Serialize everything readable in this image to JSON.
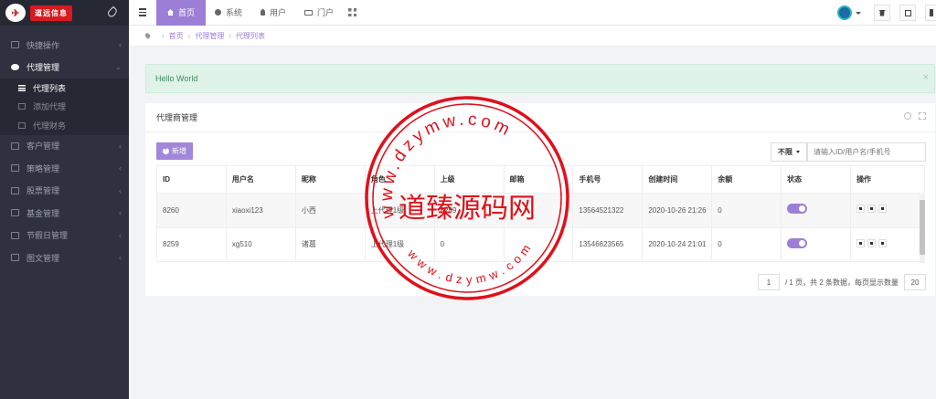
{
  "app": {
    "logo_text": "道远信息"
  },
  "sidebar": {
    "items": [
      {
        "label": "快捷操作",
        "open": false
      },
      {
        "label": "代理管理",
        "open": true
      },
      {
        "label": "客户管理",
        "open": false
      },
      {
        "label": "策略管理",
        "open": false
      },
      {
        "label": "股票管理",
        "open": false
      },
      {
        "label": "基金管理",
        "open": false
      },
      {
        "label": "节假日管理",
        "open": false
      },
      {
        "label": "图文管理",
        "open": false
      }
    ],
    "sub_items": [
      {
        "label": "代理列表",
        "active": true
      },
      {
        "label": "添加代理",
        "active": false
      },
      {
        "label": "代理财务",
        "active": false
      }
    ]
  },
  "topbar": {
    "tabs": [
      {
        "label": "首页",
        "active": true,
        "icon": "home-icon"
      },
      {
        "label": "系统",
        "active": false,
        "icon": "gear-icon"
      },
      {
        "label": "用户",
        "active": false,
        "icon": "user-icon"
      },
      {
        "label": "门户",
        "active": false,
        "icon": "portal-icon"
      }
    ]
  },
  "breadcrumb": [
    "首页",
    "代理管理",
    "代理列表"
  ],
  "alert": {
    "text": "Hello World",
    "close": "×"
  },
  "panel": {
    "title": "代理商管理",
    "add_label": "新增",
    "filter_label": "不限",
    "search_placeholder": "请输入ID/用户名/手机号"
  },
  "table": {
    "columns": [
      "ID",
      "用户名",
      "昵称",
      "角色",
      "上级",
      "邮箱",
      "手机号",
      "创建时间",
      "余额",
      "状态",
      "操作"
    ],
    "rows": [
      {
        "id": "8260",
        "username": "xiaoxi123",
        "nickname": "小西",
        "role": "上代理1级",
        "parent": "8259",
        "email": "",
        "phone": "13564521322",
        "created": "2020-10-26 21:26",
        "balance": "0",
        "enabled": true
      },
      {
        "id": "8259",
        "username": "xg510",
        "nickname": "诸葛",
        "role": "上代理1级",
        "parent": "0",
        "email": "",
        "phone": "13546623565",
        "created": "2020-10-24 21:01",
        "balance": "0",
        "enabled": true
      }
    ]
  },
  "pager": {
    "page": "1",
    "total_pages_text": "/ 1 页，共 2 条数据，每页显示数量",
    "page_size": "20"
  },
  "watermark": {
    "center_text": "道臻源码网",
    "ring_top": "www.dzymw.com",
    "ring_bottom": "www.dzymw.com",
    "color": "#e0101a"
  }
}
